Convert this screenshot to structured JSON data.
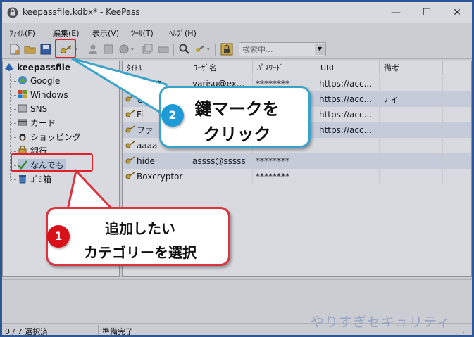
{
  "window": {
    "title": "keepassfile.kdbx* - KeePass",
    "controls": {
      "minimize": "—",
      "maximize": "☐",
      "close": "✕"
    }
  },
  "menu": [
    "ﾌｧｲﾙ(F)",
    "編集(E)",
    "表示(V)",
    "ﾂｰﾙ(T)",
    "ﾍﾙﾌﾟ(H)"
  ],
  "search": {
    "placeholder": "検索中..."
  },
  "tree": {
    "root": "keepassfile",
    "groups": [
      "Google",
      "Windows",
      "SNS",
      "カード",
      "ショッピング",
      "銀行",
      "なんでも",
      "ｺﾞﾐ箱"
    ]
  },
  "table": {
    "headers": [
      "ﾀｲﾄﾙ",
      "ﾕｰｻﾞ名",
      "ﾊﾟｽﾜｰﾄﾞ",
      "URL",
      "備考"
    ],
    "rows": [
      [
        "やりす",
        "yarisu@ex...",
        "********",
        "https://acc...",
        ""
      ],
      [
        "ぎせき",
        "",
        "",
        "https://acc...",
        "ティ"
      ],
      [
        "Fi",
        "",
        "",
        "https://acc...",
        ""
      ],
      [
        "ファ",
        "",
        "",
        "https://acc...",
        ""
      ],
      [
        "aaaa",
        "",
        "",
        "",
        ""
      ],
      [
        "hide",
        "assss@sssss",
        "********",
        "",
        ""
      ],
      [
        "Boxcryptor",
        "",
        "********",
        "",
        ""
      ]
    ]
  },
  "status": {
    "selection": "0 / 7 選択済",
    "state": "準備完了"
  },
  "callouts": {
    "step1": {
      "number": "1",
      "line1": "追加したい",
      "line2": "カテゴリーを選択"
    },
    "step2": {
      "number": "2",
      "line1": "鍵マークを",
      "line2": "クリック"
    }
  },
  "watermark": "やりすぎセキュリティ",
  "colors": {
    "accent": "#2f5fa8",
    "callout_blue": "#3aa3c9",
    "callout_red": "#d9343f",
    "badge_blue": "#1e9bd7",
    "badge_red": "#d8101a"
  }
}
